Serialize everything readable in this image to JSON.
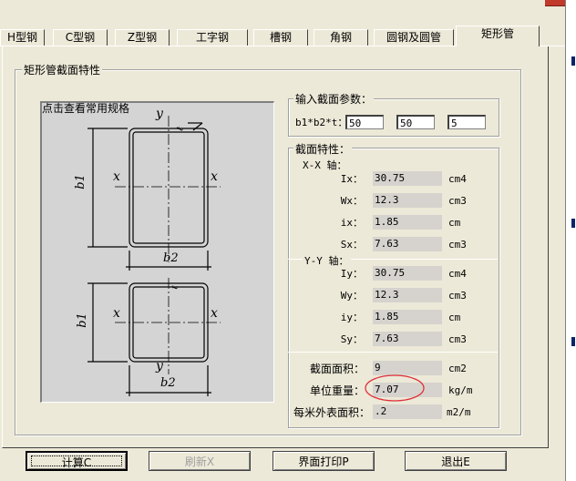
{
  "tabs": [
    {
      "label": "H型钢"
    },
    {
      "label": "C型钢"
    },
    {
      "label": "Z型钢"
    },
    {
      "label": "工字钢"
    },
    {
      "label": "槽钢"
    },
    {
      "label": "角钢"
    },
    {
      "label": "圆钢及圆管"
    },
    {
      "label": "矩形管"
    }
  ],
  "section_group": {
    "title": "矩形管截面特性"
  },
  "drawing": {
    "label": "点击查看常用规格",
    "axis_x": "x",
    "axis_y": "y",
    "dim_t": "t",
    "dim_b1": "b1",
    "dim_b2": "b2"
  },
  "input_group": {
    "title": "输入截面参数：",
    "label": "b1*b2*t：",
    "b1": "50",
    "b2": "50",
    "t": "5"
  },
  "props_group": {
    "title": "截面特性：",
    "xx_title": "X-X 轴：",
    "yy_title": "Y-Y 轴：",
    "xx": [
      {
        "label": "Ix：",
        "value": "30.75",
        "unit": "cm4"
      },
      {
        "label": "Wx：",
        "value": "12.3",
        "unit": "cm3"
      },
      {
        "label": "ix：",
        "value": "1.85",
        "unit": "cm"
      },
      {
        "label": "Sx：",
        "value": "7.63",
        "unit": "cm3"
      }
    ],
    "yy": [
      {
        "label": "Iy：",
        "value": "30.75",
        "unit": "cm4"
      },
      {
        "label": "Wy：",
        "value": "12.3",
        "unit": "cm3"
      },
      {
        "label": "iy：",
        "value": "1.85",
        "unit": "cm"
      },
      {
        "label": "Sy：",
        "value": "7.63",
        "unit": "cm3"
      }
    ],
    "area": {
      "label": "截面面积：",
      "value": "9",
      "unit": "cm2"
    },
    "weight": {
      "label": "单位重量：",
      "value": "7.07",
      "unit": "kg/m"
    },
    "surface": {
      "label": "每米外表面积：",
      "value": ".2",
      "unit": "m2/m"
    }
  },
  "buttons": {
    "calc": "计算C",
    "refresh": "刷新X",
    "print": "界面打印P",
    "exit": "退出E"
  },
  "colors": {
    "highlight_ellipse": "#e0303a",
    "value_bg": "#d6d3ce",
    "drawing_bg": "#d4d4d4"
  }
}
